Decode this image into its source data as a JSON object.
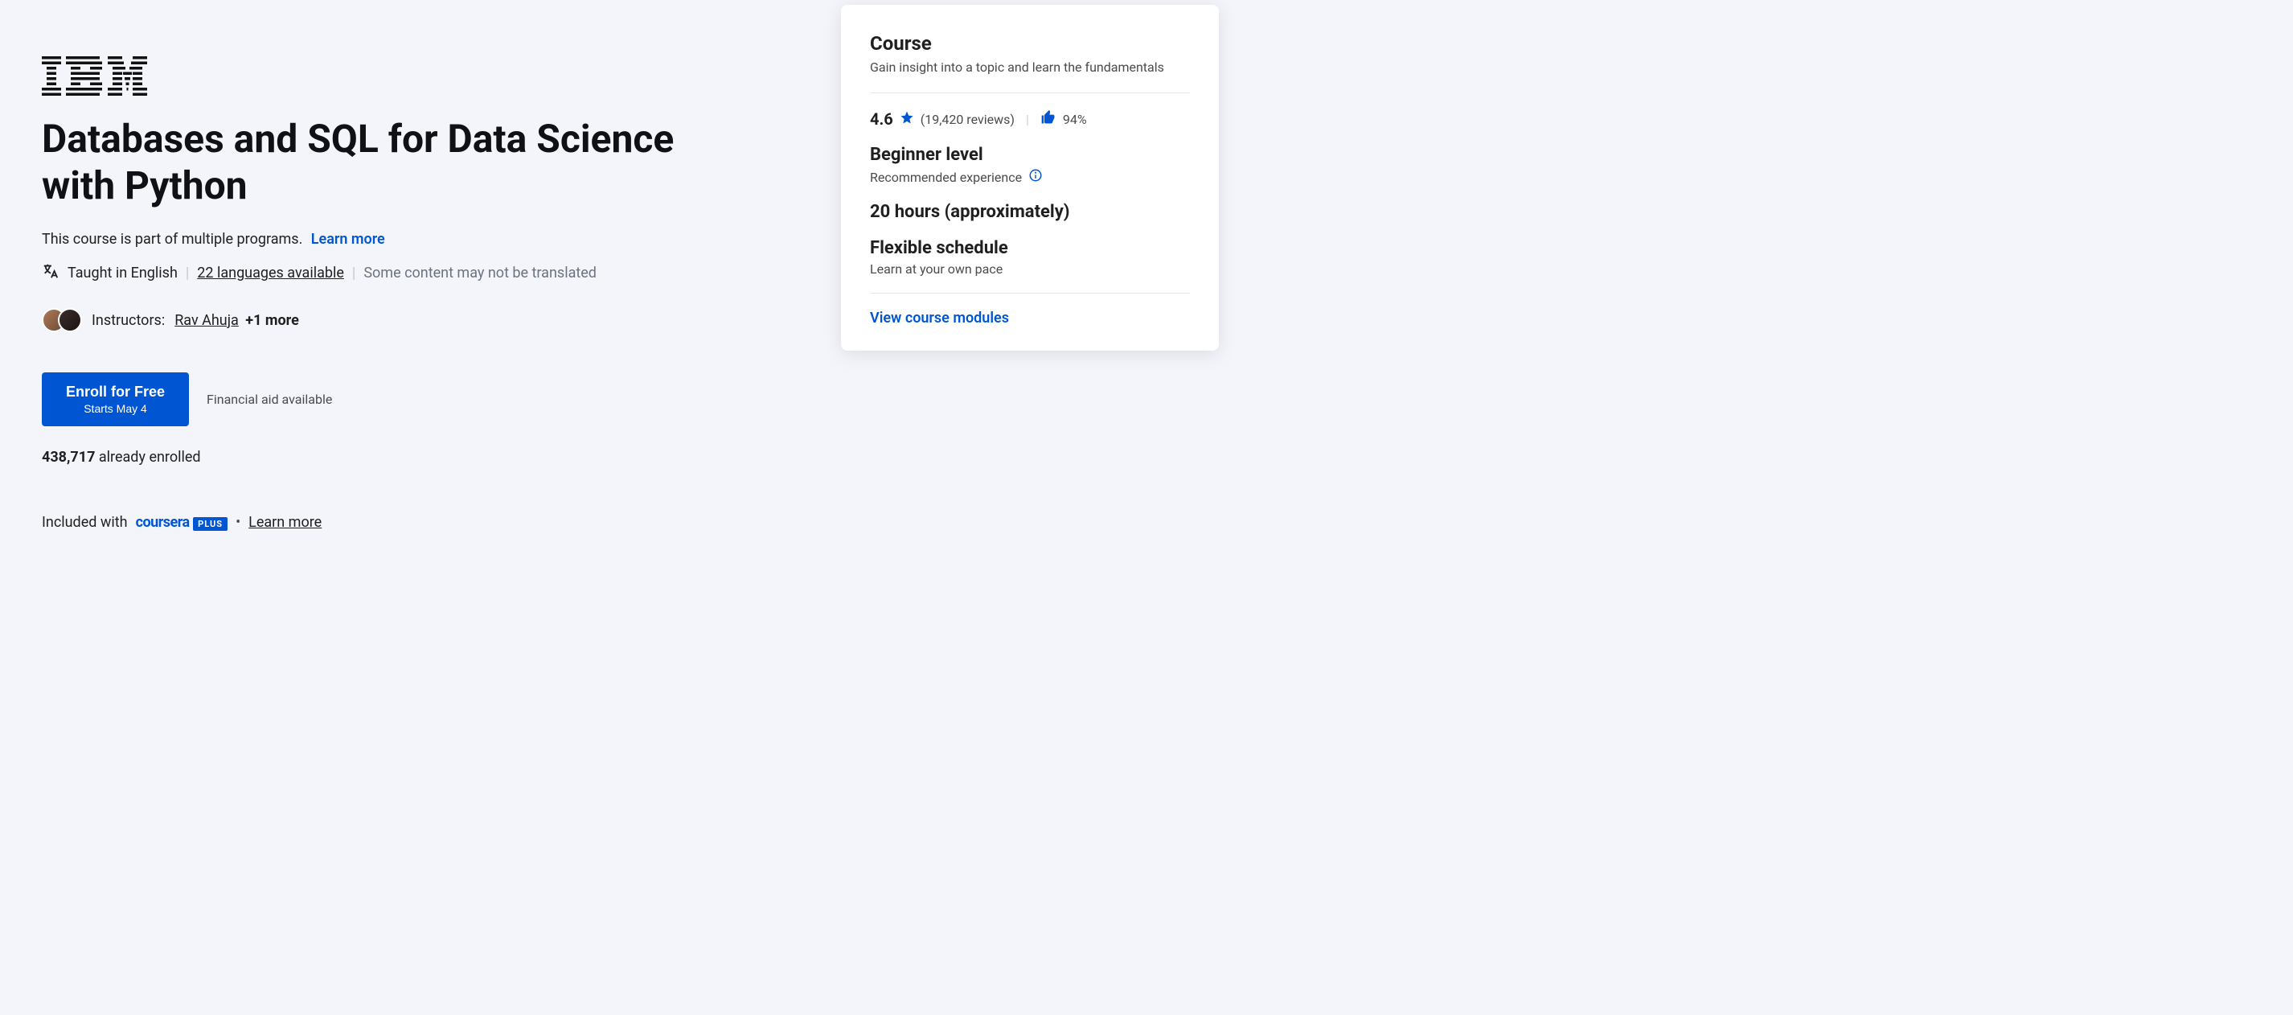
{
  "provider": {
    "name": "IBM"
  },
  "course": {
    "title": "Databases and SQL for Data Science with Python",
    "program_note": "This course is part of multiple programs.",
    "learn_more": "Learn more"
  },
  "language": {
    "taught_in": "Taught in English",
    "availability_link": "22 languages available",
    "caveat": "Some content may not be translated"
  },
  "instructors": {
    "label": "Instructors:",
    "primary": "Rav Ahuja",
    "more": "+1 more"
  },
  "enroll": {
    "cta_title": "Enroll for Free",
    "cta_sub": "Starts May 4",
    "financial_aid": "Financial aid available"
  },
  "enrolled": {
    "count": "438,717",
    "suffix": " already enrolled"
  },
  "included": {
    "prefix": "Included with",
    "brand": "coursera",
    "badge": "PLUS",
    "learn_more": "Learn more"
  },
  "sidebar": {
    "heading": "Course",
    "subheading": "Gain insight into a topic and learn the fundamentals",
    "rating": "4.6",
    "reviews": "(19,420 reviews)",
    "like_pct": "94%",
    "level_title": "Beginner level",
    "level_sub": "Recommended experience",
    "duration": "20 hours (approximately)",
    "schedule_title": "Flexible schedule",
    "schedule_sub": "Learn at your own pace",
    "modules_link": "View course modules"
  }
}
